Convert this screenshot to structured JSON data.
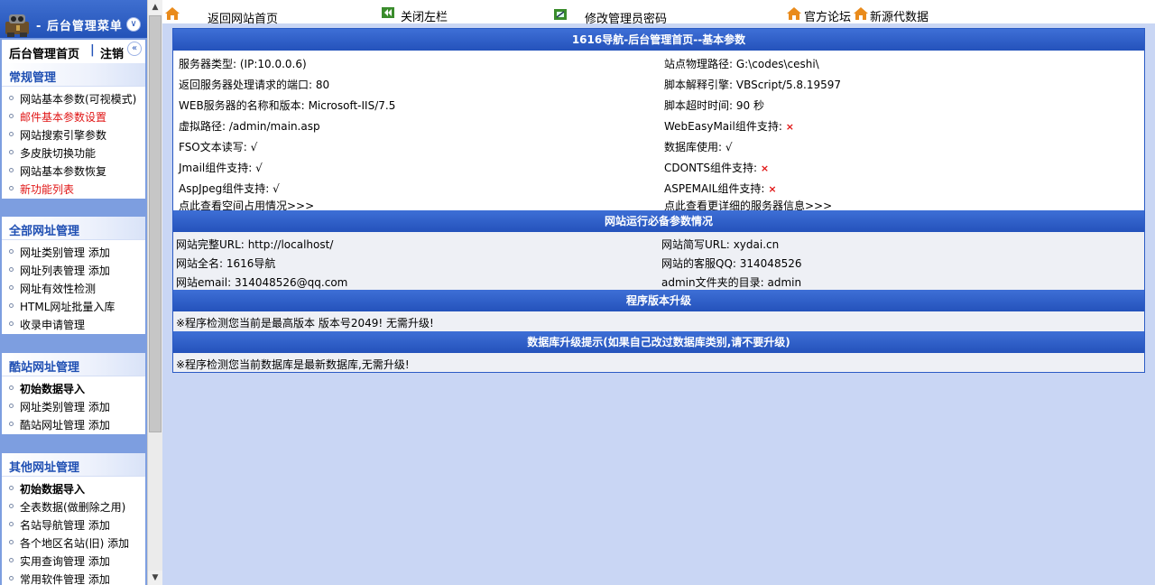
{
  "sidebar": {
    "title": "- 后台管理菜单",
    "home_link": "后台管理首页",
    "separator": "|",
    "logout_link": "注销",
    "sections": [
      {
        "title": "常规管理",
        "items": [
          {
            "label": "网站基本参数(可视模式)",
            "style": ""
          },
          {
            "label": "邮件基本参数设置",
            "style": "red"
          },
          {
            "label": "网站搜索引擎参数",
            "style": ""
          },
          {
            "label": "多皮肤切换功能",
            "style": ""
          },
          {
            "label": "网站基本参数恢复",
            "style": ""
          },
          {
            "label": "新功能列表",
            "style": "red"
          }
        ]
      },
      {
        "title": "全部网址管理",
        "items": [
          {
            "label": "网址类别管理  添加",
            "style": ""
          },
          {
            "label": "网址列表管理  添加",
            "style": ""
          },
          {
            "label": "网址有效性检测",
            "style": ""
          },
          {
            "label": "HTML网址批量入库",
            "style": ""
          },
          {
            "label": "收录申请管理",
            "style": ""
          }
        ]
      },
      {
        "title": "酷站网址管理",
        "items": [
          {
            "label": "初始数据导入",
            "style": "bold"
          },
          {
            "label": "网址类别管理  添加",
            "style": ""
          },
          {
            "label": "酷站网址管理  添加",
            "style": ""
          }
        ]
      },
      {
        "title": "其他网址管理",
        "items": [
          {
            "label": "初始数据导入",
            "style": "bold"
          },
          {
            "label": "全表数据(做删除之用)",
            "style": ""
          },
          {
            "label": "名站导航管理  添加",
            "style": ""
          },
          {
            "label": "各个地区名站(旧)  添加",
            "style": ""
          },
          {
            "label": "实用查询管理  添加",
            "style": ""
          },
          {
            "label": "常用软件管理  添加",
            "style": ""
          }
        ]
      }
    ]
  },
  "topbar": {
    "home": "返回网站首页",
    "close_left": "关闭左栏",
    "change_password": "修改管理员密码",
    "forum": "官方论坛",
    "new_data": "新源代数据"
  },
  "main": {
    "basic_title": "1616导航-后台管理首页--基本参数",
    "basic": {
      "server_type_label": "服务器类型:",
      "server_type": "(IP:10.0.0.6)",
      "physical_path_label": "站点物理路径:",
      "physical_path": "G:\\codes\\ceshi\\",
      "port_label": "返回服务器处理请求的端口:",
      "port": "80",
      "script_engine_label": "脚本解释引擎:",
      "script_engine": "VBScript/5.8.19597",
      "web_server_label": "WEB服务器的名称和版本:",
      "web_server": "Microsoft-IIS/7.5",
      "timeout_label": "脚本超时时间:",
      "timeout": "90 秒",
      "virtual_path_label": "虚拟路径:",
      "virtual_path": "/admin/main.asp",
      "webeasymail_label": "WebEasyMail组件支持:",
      "webeasymail": "×",
      "fso_label": "FSO文本读写:",
      "fso": "√",
      "database_label": "数据库使用:",
      "database": "√",
      "jmail_label": "Jmail组件支持:",
      "jmail": "√",
      "cdonts_label": "CDONTS组件支持:",
      "cdonts": "×",
      "aspjpeg_label": "AspJpeg组件支持:",
      "aspjpeg": "√",
      "aspemail_label": "ASPEMAIL组件支持:",
      "aspemail": "×",
      "space_link": "点此查看空间占用情况>>>",
      "server_info_link": "点此查看更详细的服务器信息>>>"
    },
    "run_title": "网站运行必备参数情况",
    "run": {
      "url_label": "网站完整URL:",
      "url": "http://localhost/",
      "short_url_label": "网站简写URL:",
      "short_url": "xydai.cn",
      "name_label": "网站全名:",
      "name": "1616导航",
      "qq_label": "网站的客服QQ:",
      "qq": "314048526",
      "email_label": "网站email:",
      "email": "314048526@qq.com",
      "admin_dir_label": "admin文件夹的目录:",
      "admin_dir": "admin"
    },
    "version_title": "程序版本升级",
    "version_msg": "※程序检测您当前是最高版本 版本号2049! 无需升级!",
    "db_title": "数据库升级提示(如果自己改过数据库类别,请不要升级)",
    "db_msg": "※程序检测您当前数据库是最新数据库,无需升级!"
  },
  "colors": {
    "header_blue": "#2452bb",
    "red": "#e01515",
    "background": "#c9d6f4"
  }
}
